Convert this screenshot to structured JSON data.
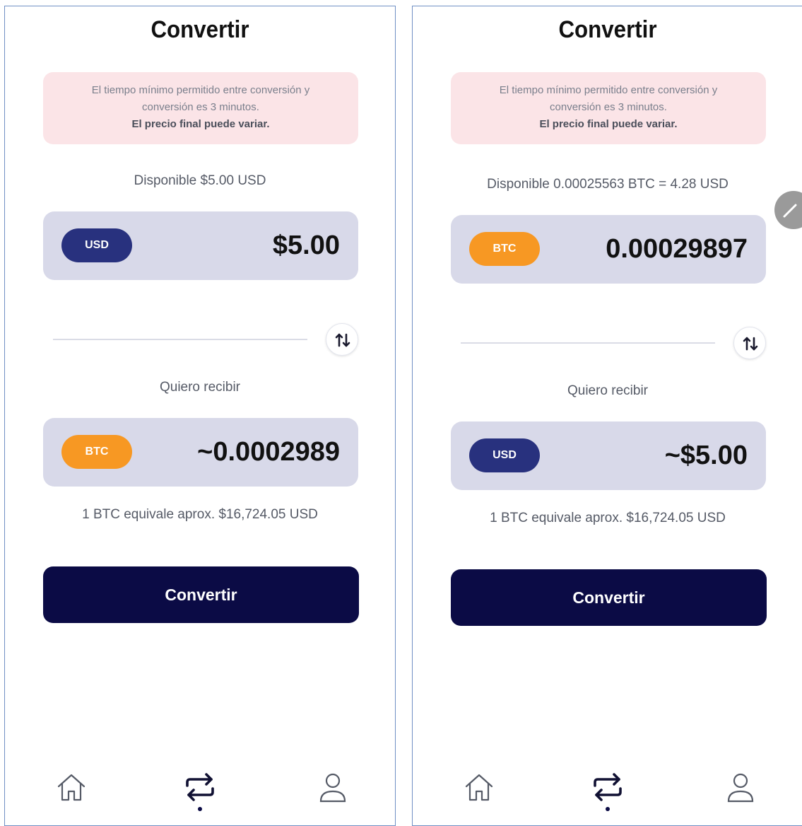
{
  "left": {
    "title": "Convertir",
    "notice": {
      "line1": "El tiempo mínimo permitido entre conversión y",
      "line2": "conversión es 3 minutos.",
      "line3": "El precio final puede variar."
    },
    "available": "Disponible $5.00 USD",
    "from": {
      "currency": "USD",
      "amount": "$5.00"
    },
    "receive_label": "Quiero recibir",
    "to": {
      "currency": "BTC",
      "amount": "~0.0002989"
    },
    "rate": "1 BTC equivale aprox. $16,724.05 USD",
    "convert_label": "Convertir"
  },
  "right": {
    "title": "Convertir",
    "notice": {
      "line1": "El tiempo mínimo permitido entre conversión y",
      "line2": "conversión es 3 minutos.",
      "line3": "El precio final puede variar."
    },
    "available": "Disponible 0.00025563 BTC = 4.28 USD",
    "from": {
      "currency": "BTC",
      "amount": "0.00029897"
    },
    "receive_label": "Quiero recibir",
    "to": {
      "currency": "USD",
      "amount": "~$5.00"
    },
    "rate": "1 BTC equivale aprox. $16,724.05 USD",
    "convert_label": "Convertir"
  },
  "nav": {
    "items": [
      {
        "icon": "home-icon",
        "active": false
      },
      {
        "icon": "convert-icon",
        "active": true
      },
      {
        "icon": "profile-icon",
        "active": false
      }
    ]
  },
  "colors": {
    "usd_chip": "#28317e",
    "btc_chip": "#f79823",
    "primary_button": "#0b0b45",
    "amount_box": "#d8d9e9",
    "notice_bg": "#fbe4e7"
  }
}
